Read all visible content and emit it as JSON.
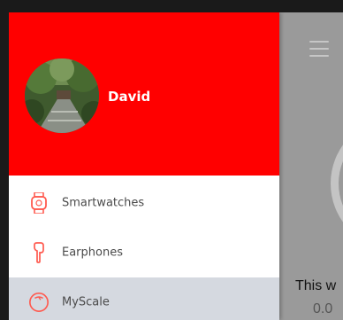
{
  "profile": {
    "name": "David",
    "avatar_desc": "avatar-photo"
  },
  "menu": {
    "items": [
      {
        "label": "Smartwatches",
        "icon": "watch-icon",
        "selected": false
      },
      {
        "label": "Earphones",
        "icon": "earphone-icon",
        "selected": false
      },
      {
        "label": "MyScale",
        "icon": "scale-icon",
        "selected": true
      }
    ]
  },
  "main": {
    "week_label": "This w",
    "week_value": "0.0"
  },
  "colors": {
    "header": "#ff0000",
    "accent_icon": "#ff3b30",
    "selected_bg": "#d5d9e0",
    "dim_overlay": "#9a9a9a"
  }
}
